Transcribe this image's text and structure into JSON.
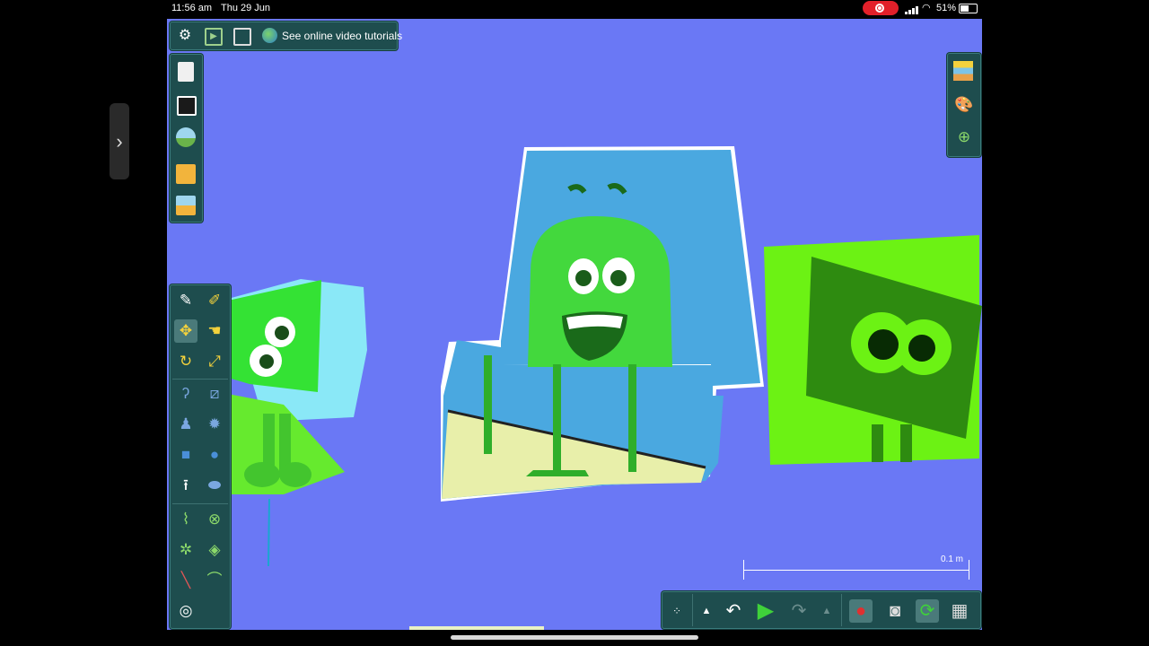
{
  "status_bar": {
    "time": "11:56 am",
    "date": "Thu 29 Jun",
    "battery_pct": "51%",
    "recording": true
  },
  "top_toolbar": {
    "icons": [
      "gear-icon",
      "play-window-icon",
      "window-icon"
    ],
    "tutorial_label": "See online video tutorials"
  },
  "file_toolbar": {
    "icons": [
      "new-document-icon",
      "toolbox-icon",
      "import-image-icon",
      "open-folder-icon",
      "save-landscape-icon"
    ]
  },
  "tool_palette": {
    "selected": "move-tool",
    "tools": [
      "brush-tool",
      "sketch-tool",
      "move-tool",
      "grab-tool",
      "rotate-tool",
      "scale-tool",
      "rope-tool",
      "cut-tool",
      "spring-tool",
      "gear-tool",
      "box-tool",
      "circle-tool",
      "fixate-tool",
      "plane-tool",
      "zigzag-spring-tool",
      "delete-tool",
      "hinge-tool",
      "thruster-tool",
      "laser-tool",
      "tracer-tool",
      "texture-tool"
    ]
  },
  "right_toolbar": {
    "icons": [
      "background-layers-icon",
      "color-palette-icon",
      "zoom-tree-icon"
    ]
  },
  "bottom_toolbar": {
    "icons": [
      "grid-dots-icon",
      "triangle-up-icon",
      "undo-icon",
      "play-icon",
      "redo-icon",
      "triangle-up-icon",
      "gravity-apple-icon",
      "camera-record-icon",
      "simulation-settings-icon",
      "grid-icon"
    ],
    "colors": {
      "play": "#3fd13a",
      "bar": "#1e4d4e"
    }
  },
  "scale_indicator": {
    "label": "0.1 m"
  },
  "canvas": {
    "background": "#6a78f5"
  }
}
